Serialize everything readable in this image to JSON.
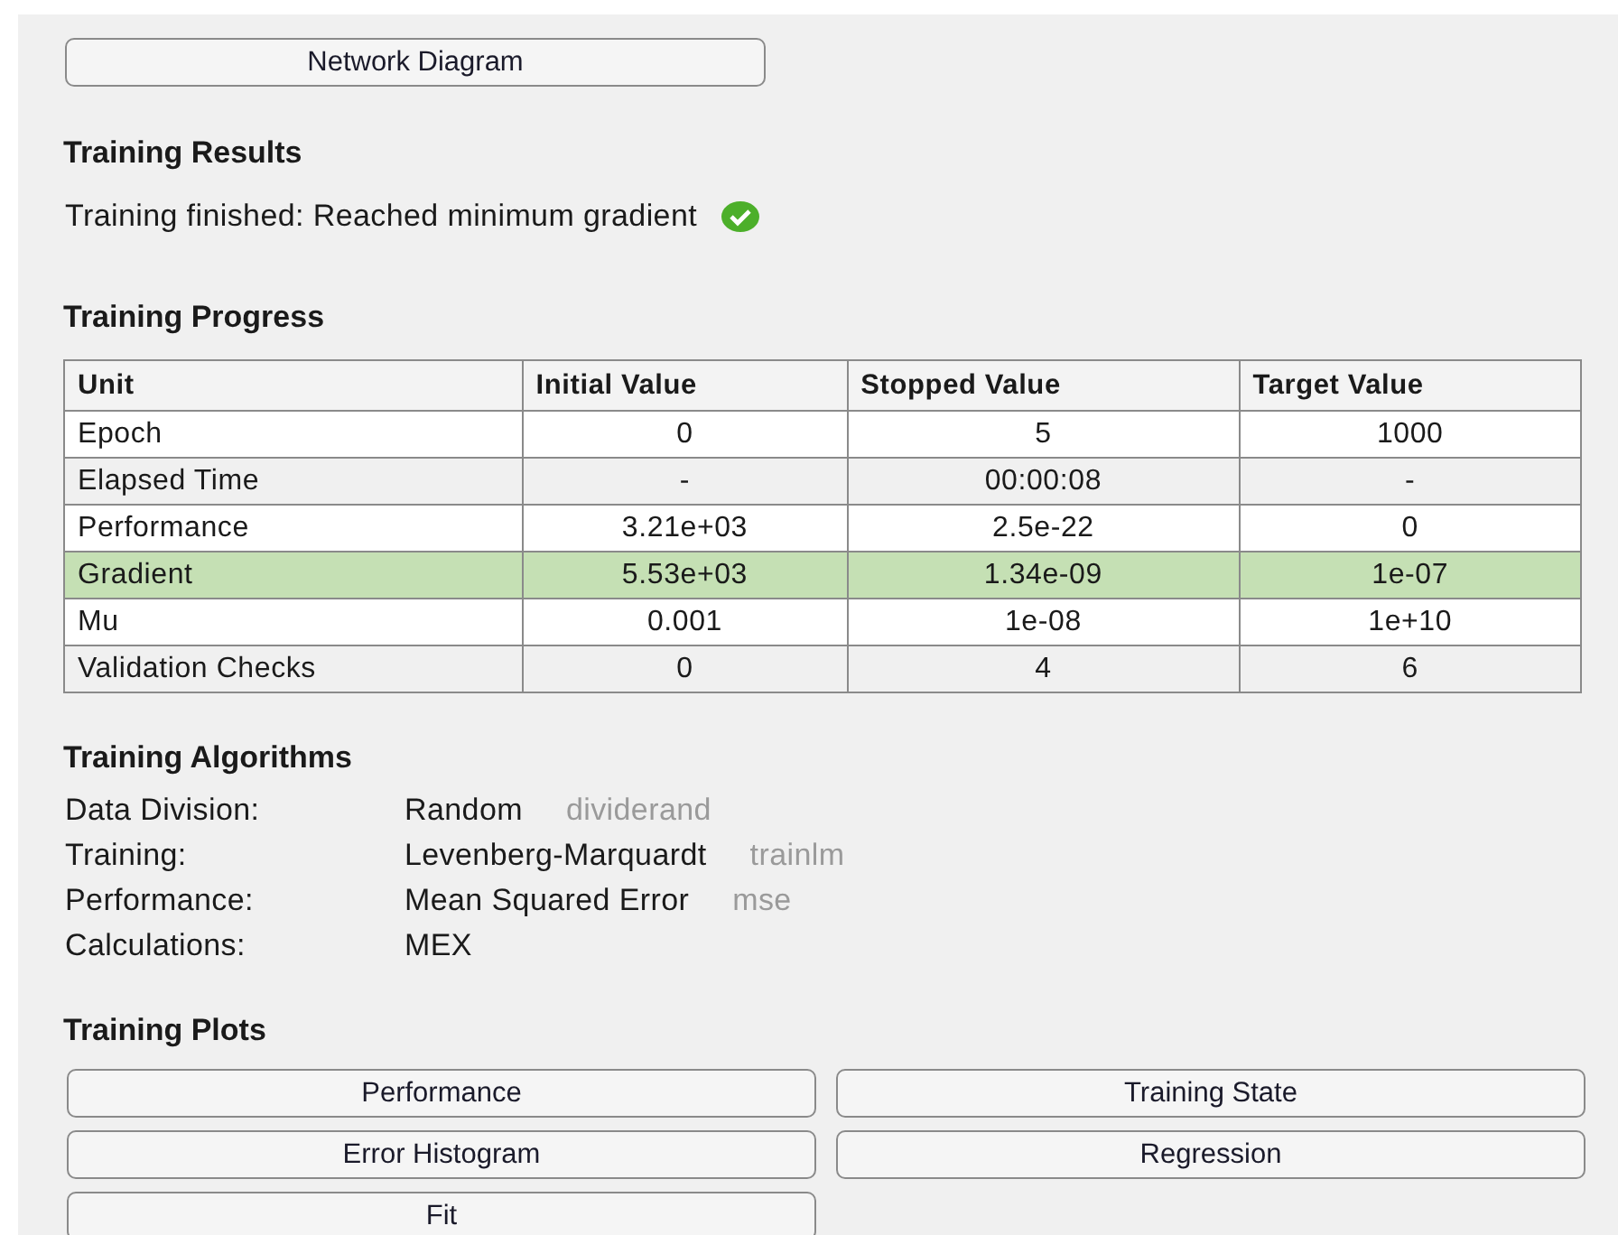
{
  "network_button": "Network Diagram",
  "results": {
    "title": "Training Results",
    "message": "Training finished: Reached minimum gradient",
    "success": true
  },
  "progress": {
    "title": "Training Progress",
    "columns": [
      "Unit",
      "Initial Value",
      "Stopped Value",
      "Target Value"
    ],
    "rows": [
      {
        "cells": [
          "Epoch",
          "0",
          "5",
          "1000"
        ],
        "highlighted": false
      },
      {
        "cells": [
          "Elapsed Time",
          "-",
          "00:00:08",
          "-"
        ],
        "highlighted": false
      },
      {
        "cells": [
          "Performance",
          "3.21e+03",
          "2.5e-22",
          "0"
        ],
        "highlighted": false
      },
      {
        "cells": [
          "Gradient",
          "5.53e+03",
          "1.34e-09",
          "1e-07"
        ],
        "highlighted": true
      },
      {
        "cells": [
          "Mu",
          "0.001",
          "1e-08",
          "1e+10"
        ],
        "highlighted": false
      },
      {
        "cells": [
          "Validation Checks",
          "0",
          "4",
          "6"
        ],
        "highlighted": false
      }
    ]
  },
  "algorithms": {
    "title": "Training Algorithms",
    "items": [
      {
        "label": "Data Division:",
        "value": "Random",
        "function": "dividerand"
      },
      {
        "label": "Training:",
        "value": "Levenberg-Marquardt",
        "function": "trainlm"
      },
      {
        "label": "Performance:",
        "value": "Mean Squared Error",
        "function": "mse"
      },
      {
        "label": "Calculations:",
        "value": "MEX"
      }
    ]
  },
  "plots": {
    "title": "Training Plots",
    "buttons": [
      "Performance",
      "Training State",
      "Error Histogram",
      "Regression",
      "Fit"
    ]
  }
}
